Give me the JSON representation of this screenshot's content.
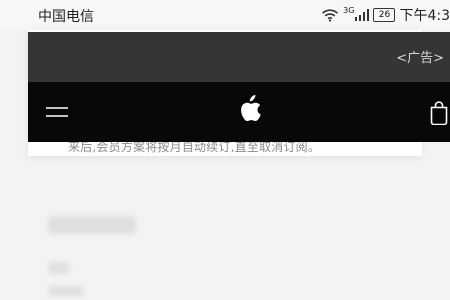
{
  "status_bar": {
    "carrier": "中国电信",
    "network": "3G",
    "battery": "26",
    "time": "下午4:3"
  },
  "background": {
    "note": "来后,会员方案将按月自动续订,直至取消订阅。"
  },
  "ad": {
    "label": "<广告>"
  },
  "nav": {
    "menu_icon": "hamburger-menu-icon",
    "logo_icon": "apple-icon",
    "bag_icon": "shopping-bag-icon"
  },
  "colors": {
    "status_bg": "#f7f7f7",
    "ad_bg": "#353535",
    "nav_bg": "#080808",
    "text": "#222222",
    "muted": "#8b8b8b"
  }
}
